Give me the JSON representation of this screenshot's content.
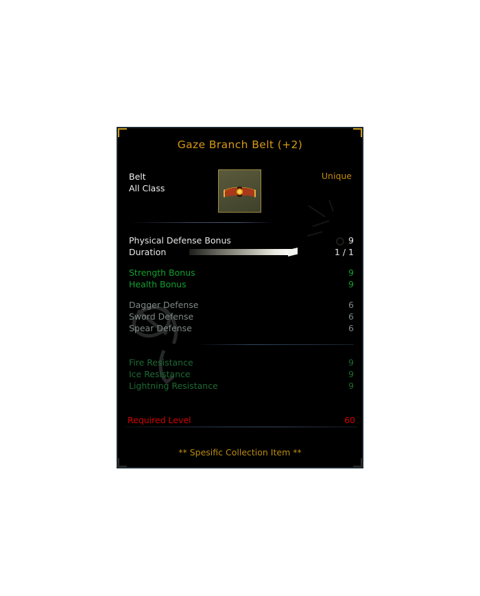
{
  "panel": {
    "title": "Gaze Branch Belt (+2)",
    "type_label": "Belt",
    "class_label": "All Class",
    "rarity_label": "Unique",
    "icon_name": "belt-item-icon",
    "collection_note": "** Spesific Collection Item **",
    "colors": {
      "title": "#d79a14",
      "rarity": "#c28c0e",
      "white_stat": "#eaeaea",
      "green_stat": "#12a02e",
      "dim_stat": "#7e8a83",
      "dark_green_stat": "#1d6b33",
      "required_level": "#d50000",
      "border": "#1b2733",
      "corner_accent": "#c79a18",
      "panel_background": "#000000"
    }
  },
  "stats": {
    "base": [
      {
        "label": "Physical Defense Bonus",
        "value": "9",
        "style": "white"
      },
      {
        "label": "Duration",
        "value": "1 / 1",
        "style": "white",
        "bar": true,
        "bar_fill_percent": 100
      }
    ],
    "bonuses": [
      {
        "label": "Strength Bonus",
        "value": "9",
        "style": "green"
      },
      {
        "label": "Health Bonus",
        "value": "9",
        "style": "green"
      }
    ],
    "defenses": [
      {
        "label": "Dagger Defense",
        "value": "6",
        "style": "dim"
      },
      {
        "label": "Sword Defense",
        "value": "6",
        "style": "dim"
      },
      {
        "label": "Spear Defense",
        "value": "6",
        "style": "dim"
      }
    ],
    "resistances": [
      {
        "label": "Fire Resistance",
        "value": "9",
        "style": "dark-green"
      },
      {
        "label": "Ice Resistance",
        "value": "9",
        "style": "dark-green"
      },
      {
        "label": "Lightning Resistance",
        "value": "9",
        "style": "dark-green"
      }
    ],
    "requirement": {
      "label": "Required Level",
      "value": "60",
      "style": "red"
    }
  }
}
